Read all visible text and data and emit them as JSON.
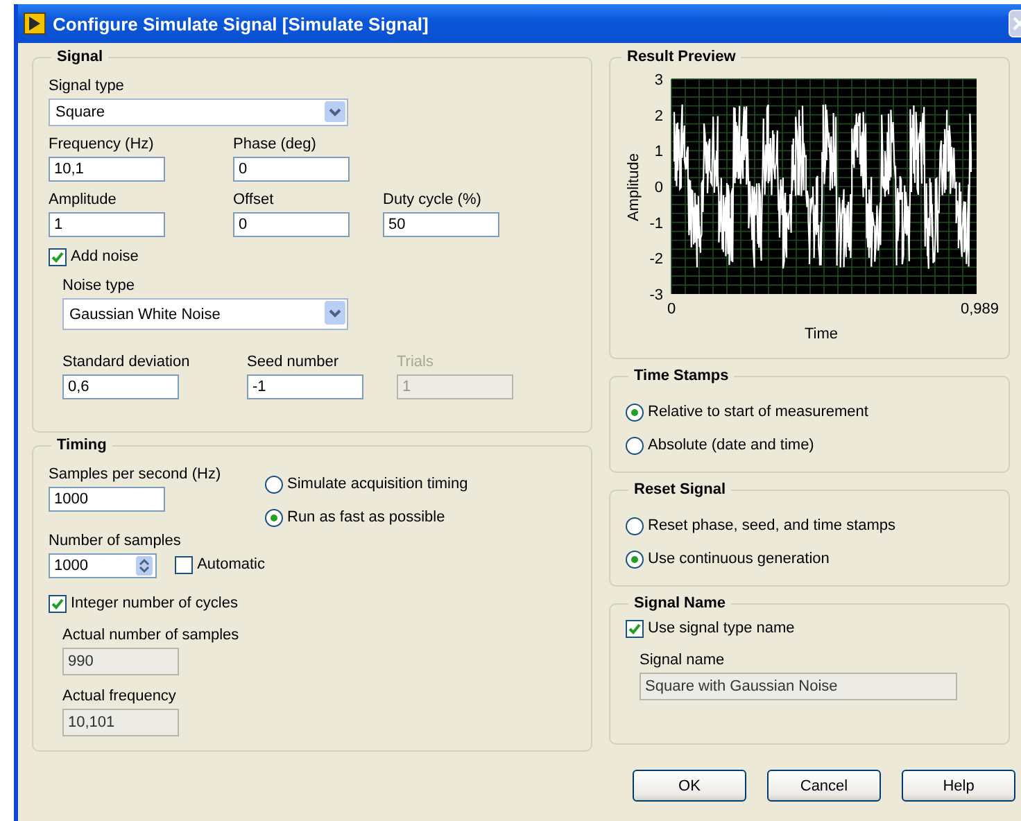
{
  "window": {
    "title": "Configure Simulate Signal [Simulate Signal]"
  },
  "signal": {
    "title": "Signal",
    "signal_type": {
      "label": "Signal type",
      "value": "Square"
    },
    "row1": [
      {
        "label": "Frequency (Hz)",
        "value": "10,1",
        "disabled": false
      },
      {
        "label": "Phase (deg)",
        "value": "0",
        "disabled": false
      }
    ],
    "row2": [
      {
        "label": "Amplitude",
        "value": "1",
        "disabled": false
      },
      {
        "label": "Offset",
        "value": "0",
        "disabled": false
      },
      {
        "label": "Duty cycle (%)",
        "value": "50",
        "disabled": false
      }
    ],
    "add_noise": {
      "label": "Add noise",
      "checked": true
    },
    "noise_type": {
      "label": "Noise type",
      "value": "Gaussian White Noise"
    },
    "noise_fields": [
      {
        "label": "Standard deviation",
        "value": "0,6",
        "disabled": false
      },
      {
        "label": "Seed number",
        "value": "-1",
        "disabled": false
      },
      {
        "label": "Trials",
        "value": "1",
        "disabled": true
      }
    ]
  },
  "timing": {
    "title": "Timing",
    "samples_per_second": {
      "label": "Samples per second (Hz)",
      "value": "1000",
      "disabled": false
    },
    "number_of_samples": {
      "label": "Number of samples",
      "value": "1000"
    },
    "automatic": {
      "label": "Automatic",
      "checked": false
    },
    "modes": [
      {
        "label": "Simulate acquisition timing",
        "selected": false
      },
      {
        "label": "Run as fast as possible",
        "selected": true
      }
    ],
    "integer_cycles": {
      "label": "Integer number of cycles",
      "checked": true
    },
    "actual": [
      {
        "label": "Actual number of samples",
        "value": "990",
        "disabled": true
      },
      {
        "label": "Actual frequency",
        "value": "10,101",
        "disabled": true
      }
    ]
  },
  "result_preview": {
    "title": "Result Preview",
    "ylabel": "Amplitude",
    "xlabel": "Time",
    "yticks": [
      "3",
      "2",
      "1",
      "0",
      "-1",
      "-2",
      "-3"
    ],
    "xticks": [
      "0",
      "0,989"
    ]
  },
  "time_stamps": {
    "title": "Time Stamps",
    "options": [
      {
        "label": "Relative to start of measurement",
        "selected": true
      },
      {
        "label": "Absolute (date and time)",
        "selected": false
      }
    ]
  },
  "reset_signal": {
    "title": "Reset Signal",
    "options": [
      {
        "label": "Reset phase, seed, and time stamps",
        "selected": false
      },
      {
        "label": "Use continuous generation",
        "selected": true
      }
    ]
  },
  "signal_name": {
    "title": "Signal Name",
    "use_type_name": {
      "label": "Use signal type name",
      "checked": true
    },
    "name": {
      "label": "Signal name",
      "value": "Square with Gaussian Noise",
      "disabled": true
    }
  },
  "buttons": [
    "OK",
    "Cancel",
    "Help"
  ]
}
